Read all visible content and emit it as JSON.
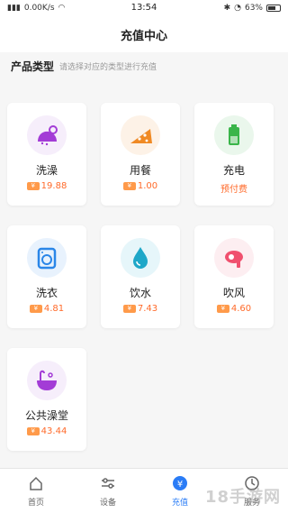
{
  "status": {
    "network": "0.00K/s",
    "time": "13:54",
    "battery": "63%"
  },
  "header": {
    "title": "充值中心"
  },
  "section": {
    "title": "产品类型",
    "hint": "请选择对应的类型进行充值"
  },
  "products": [
    {
      "name": "洗澡",
      "price": "19.88",
      "icon": "shower-icon",
      "color": "#a33cd6",
      "bg": "#f6eefb"
    },
    {
      "name": "用餐",
      "price": "1.00",
      "icon": "meal-icon",
      "color": "#f08a24",
      "bg": "#fdf2e7"
    },
    {
      "name": "充电",
      "price": "预付费",
      "icon": "battery-icon",
      "color": "#3ab54a",
      "bg": "#eaf7ec",
      "prepaid": true
    },
    {
      "name": "洗衣",
      "price": "4.81",
      "icon": "washer-icon",
      "color": "#2a86e8",
      "bg": "#e8f2fd"
    },
    {
      "name": "饮水",
      "price": "7.43",
      "icon": "water-drop-icon",
      "color": "#1ea7c8",
      "bg": "#e6f6fa"
    },
    {
      "name": "吹风",
      "price": "4.60",
      "icon": "hair-dryer-icon",
      "color": "#f0506e",
      "bg": "#fdeef1"
    },
    {
      "name": "公共澡堂",
      "price": "43.44",
      "icon": "bathtub-icon",
      "color": "#a33cd6",
      "bg": "#f6eefb"
    }
  ],
  "currency_symbol": "¥",
  "tabs": [
    {
      "label": "首页",
      "icon": "home-icon"
    },
    {
      "label": "设备",
      "icon": "sliders-icon"
    },
    {
      "label": "充值",
      "icon": "recharge-icon",
      "active": true
    },
    {
      "label": "服务",
      "icon": "user-icon"
    }
  ],
  "watermark": "18手游网"
}
